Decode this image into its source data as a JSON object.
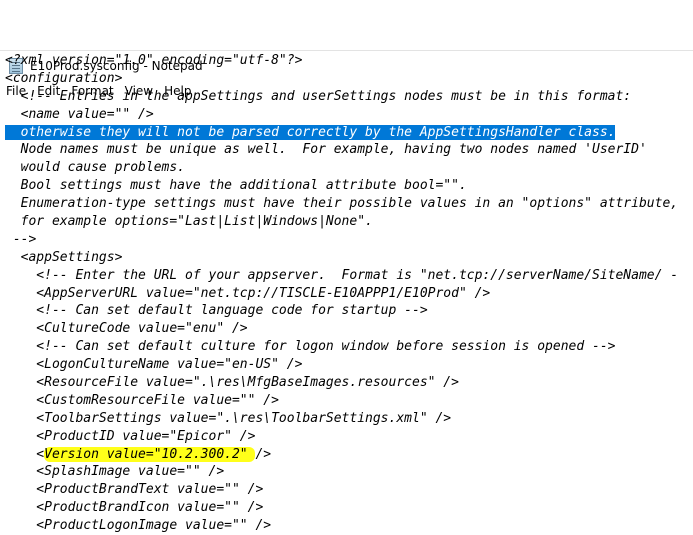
{
  "window": {
    "title": "E10Prod.sysconfig - Notepad",
    "icon": "notepad-icon"
  },
  "menu": [
    "File",
    "Edit",
    "Format",
    "View",
    "Help"
  ],
  "lines": [
    "<?xml version=\"1.0\" encoding=\"utf-8\"?>",
    "<configuration>",
    "  <!-- Entries in the appSettings and userSettings nodes must be in this format:",
    "  <name value=\"\" />",
    "  otherwise they will not be parsed correctly by the AppSettingsHandler class.",
    "  Node names must be unique as well.  For example, having two nodes named 'UserID'",
    "  would cause problems.",
    "  Bool settings must have the additional attribute bool=\"\".",
    "  Enumeration-type settings must have their possible values in an \"options\" attribute,",
    "  for example options=\"Last|List|Windows|None\".",
    " -->",
    "  <appSettings>",
    "    <!-- Enter the URL of your appserver.  Format is \"net.tcp://serverName/SiteName/ -",
    "    <AppServerURL value=\"net.tcp://TISCLE-E10APPP1/E10Prod\" />",
    "    <!-- Can set default language code for startup -->",
    "    <CultureCode value=\"enu\" />",
    "    <!-- Can set default culture for logon window before session is opened -->",
    "    <LogonCultureName value=\"en-US\" />",
    "    <ResourceFile value=\".\\res\\MfgBaseImages.resources\" />",
    "    <CustomResourceFile value=\"\" />",
    "    <ToolbarSettings value=\".\\res\\ToolbarSettings.xml\" />",
    "    <ProductID value=\"Epicor\" />",
    "    <Version value=\"10.2.300.2\" />",
    "    <SplashImage value=\"\" />",
    "    <ProductBrandText value=\"\" />",
    "    <ProductBrandIcon value=\"\" />",
    "    <ProductLogonImage value=\"\" />"
  ],
  "version_line": {
    "prefix": "    <",
    "highlighted": "Version value=\"10.2.300.2\" ",
    "suffix": "/>"
  },
  "colors": {
    "selection": "#0078d7",
    "highlight": "#ffff1a"
  }
}
